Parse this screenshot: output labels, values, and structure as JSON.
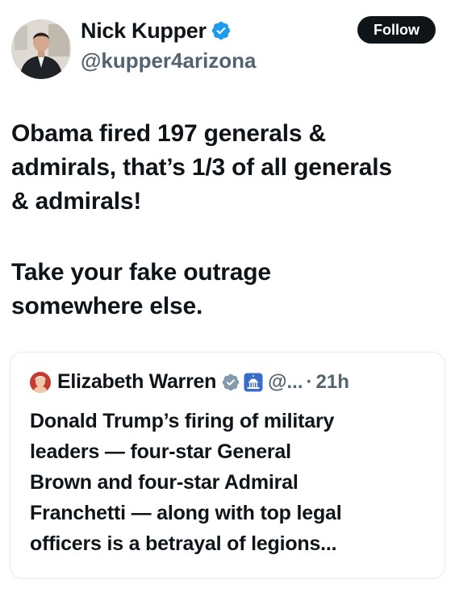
{
  "author": {
    "display_name": "Nick Kupper",
    "handle": "@kupper4arizona",
    "verified_badge_color": "#1d9bf0"
  },
  "follow_button": {
    "label": "Follow"
  },
  "tweet": {
    "paragraph_1": "Obama fired 197 generals &\nadmirals, that’s 1/3 of all generals\n& admirals!",
    "paragraph_2": "Take your fake outrage\nsomewhere else."
  },
  "quoted_tweet": {
    "display_name": "Elizabeth Warren",
    "verified_badge_color": "#829aab",
    "affiliation_icon": "us-capitol-icon",
    "handle": "@...",
    "separator": "·",
    "time": "21h",
    "text": "Donald Trump’s firing of military\nleaders — four-star General\nBrown and four-star Admiral\nFranchetti — along with top legal\nofficers is a betrayal of legions..."
  }
}
